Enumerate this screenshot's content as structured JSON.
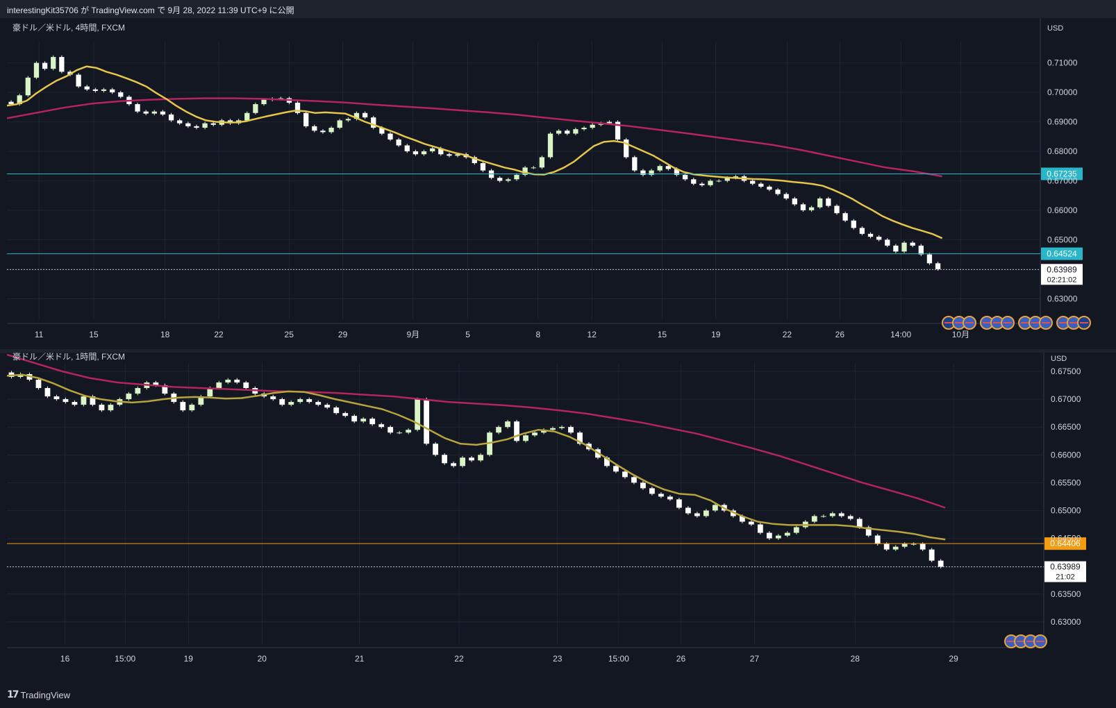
{
  "header": {
    "text": "interestingKit35706 が TradingView.com で 9月 28, 2022 11:39 UTC+9 に公開"
  },
  "footer": {
    "brand": "TradingView"
  },
  "colors": {
    "bg": "#131722",
    "grid": "#2a2e39",
    "up": "#d9f5c8",
    "down": "#ffffff",
    "ema_short": "#e5c54a",
    "ema_short_2": "#b8a43c",
    "ema_long": "#b5245e",
    "hline": "#29b6c8",
    "hline_orange": "#f39c12"
  },
  "chart_data": [
    {
      "type": "candlestick",
      "title": "豪ドル／米ドル, 4時間, FXCM",
      "currency": "USD",
      "ylim": [
        0.623,
        0.7125
      ],
      "yticks": [
        {
          "v": 0.71,
          "label": "0.71000"
        },
        {
          "v": 0.7,
          "label": "0.70000"
        },
        {
          "v": 0.69,
          "label": "0.69000"
        },
        {
          "v": 0.68,
          "label": "0.68000"
        },
        {
          "v": 0.67,
          "label": "0.67000"
        },
        {
          "v": 0.66,
          "label": "0.66000"
        },
        {
          "v": 0.65,
          "label": "0.65000"
        },
        {
          "v": 0.63,
          "label": "0.63000"
        }
      ],
      "xlim": [
        0,
        100
      ],
      "xticks": [
        {
          "x": 3.1,
          "label": "11"
        },
        {
          "x": 8.4,
          "label": "15"
        },
        {
          "x": 15.3,
          "label": "18"
        },
        {
          "x": 20.5,
          "label": "22"
        },
        {
          "x": 27.3,
          "label": "25"
        },
        {
          "x": 32.5,
          "label": "29"
        },
        {
          "x": 39.3,
          "label": "9月"
        },
        {
          "x": 44.6,
          "label": "5"
        },
        {
          "x": 51.4,
          "label": "8"
        },
        {
          "x": 56.6,
          "label": "12"
        },
        {
          "x": 63.4,
          "label": "15"
        },
        {
          "x": 68.6,
          "label": "19"
        },
        {
          "x": 75.5,
          "label": "22"
        },
        {
          "x": 80.6,
          "label": "26"
        },
        {
          "x": 86.5,
          "label": "14:00"
        },
        {
          "x": 92.3,
          "label": "10月"
        }
      ],
      "close": [
        0.696,
        0.699,
        0.705,
        0.71,
        0.708,
        0.712,
        0.707,
        0.706,
        0.702,
        0.701,
        0.7005,
        0.701,
        0.7,
        0.6985,
        0.696,
        0.6935,
        0.6928,
        0.6935,
        0.6925,
        0.6905,
        0.6895,
        0.6885,
        0.688,
        0.6895,
        0.689,
        0.6905,
        0.6895,
        0.6905,
        0.693,
        0.696,
        0.6975,
        0.6978,
        0.698,
        0.6965,
        0.693,
        0.6885,
        0.687,
        0.6865,
        0.688,
        0.6905,
        0.691,
        0.693,
        0.6915,
        0.688,
        0.686,
        0.684,
        0.682,
        0.68,
        0.679,
        0.68,
        0.681,
        0.679,
        0.6785,
        0.679,
        0.678,
        0.676,
        0.6735,
        0.671,
        0.67,
        0.6705,
        0.672,
        0.6745,
        0.6745,
        0.678,
        0.686,
        0.687,
        0.686,
        0.6875,
        0.688,
        0.689,
        0.6895,
        0.69,
        0.684,
        0.678,
        0.6735,
        0.672,
        0.6735,
        0.675,
        0.674,
        0.672,
        0.6705,
        0.669,
        0.6685,
        0.67,
        0.67,
        0.671,
        0.6715,
        0.67,
        0.669,
        0.668,
        0.667,
        0.6655,
        0.664,
        0.662,
        0.66,
        0.661,
        0.664,
        0.6615,
        0.659,
        0.6565,
        0.654,
        0.652,
        0.651,
        0.65,
        0.648,
        0.646,
        0.649,
        0.648,
        0.645,
        0.642,
        0.64
      ],
      "ema_short": [
        0.6955,
        0.696,
        0.6972,
        0.6998,
        0.702,
        0.704,
        0.7055,
        0.7075,
        0.7088,
        0.7083,
        0.707,
        0.706,
        0.7048,
        0.7035,
        0.702,
        0.6998,
        0.6978,
        0.6955,
        0.6935,
        0.6918,
        0.6905,
        0.69,
        0.6898,
        0.6898,
        0.6902,
        0.691,
        0.6918,
        0.6925,
        0.6932,
        0.6938,
        0.6936,
        0.693,
        0.6932,
        0.693,
        0.6928,
        0.6915,
        0.69,
        0.6888,
        0.6876,
        0.6864,
        0.685,
        0.6838,
        0.6825,
        0.6815,
        0.6805,
        0.6795,
        0.6788,
        0.6775,
        0.6765,
        0.6755,
        0.6745,
        0.6738,
        0.6728,
        0.6722,
        0.6721,
        0.673,
        0.6745,
        0.6765,
        0.6792,
        0.6818,
        0.6832,
        0.6835,
        0.683,
        0.6815,
        0.68,
        0.6785,
        0.6765,
        0.6745,
        0.673,
        0.6722,
        0.6718,
        0.6715,
        0.6712,
        0.671,
        0.6708,
        0.6706,
        0.6705,
        0.6703,
        0.67,
        0.6696,
        0.6693,
        0.6689,
        0.6683,
        0.667,
        0.6655,
        0.6638,
        0.6618,
        0.66,
        0.658,
        0.6565,
        0.6552,
        0.654,
        0.653,
        0.652,
        0.6505
      ],
      "ema_long": [
        0.6912,
        0.693,
        0.6948,
        0.6962,
        0.697,
        0.6975,
        0.6978,
        0.698,
        0.698,
        0.6978,
        0.6974,
        0.697,
        0.6965,
        0.6958,
        0.6952,
        0.6946,
        0.6939,
        0.6932,
        0.6924,
        0.6914,
        0.6904,
        0.6895,
        0.6885,
        0.6873,
        0.6861,
        0.6848,
        0.6835,
        0.6822,
        0.6805,
        0.6785,
        0.6765,
        0.6745,
        0.6732,
        0.6715
      ],
      "hlines": [
        {
          "v": 0.67235,
          "label": "0.67235"
        },
        {
          "v": 0.64524,
          "label": "0.64524"
        }
      ],
      "last": {
        "v": 0.63989,
        "label": "0.63989",
        "timer": "02:21:02"
      },
      "events": [
        "AUD",
        "USD",
        "USD",
        "USD",
        "USD",
        "USD",
        "USD",
        "USD",
        "USD",
        "USD",
        "USD",
        "AUD"
      ]
    },
    {
      "type": "candlestick",
      "title": "豪ドル／米ドル, 1時間, FXCM",
      "currency": "USD",
      "ylim": [
        0.626,
        0.674
      ],
      "yticks": [
        {
          "v": 0.675,
          "label": "0.67500"
        },
        {
          "v": 0.67,
          "label": "0.67000"
        },
        {
          "v": 0.665,
          "label": "0.66500"
        },
        {
          "v": 0.66,
          "label": "0.66000"
        },
        {
          "v": 0.655,
          "label": "0.65500"
        },
        {
          "v": 0.65,
          "label": "0.65000"
        },
        {
          "v": 0.645,
          "label": "0.64500"
        },
        {
          "v": 0.635,
          "label": "0.63500"
        },
        {
          "v": 0.63,
          "label": "0.63000"
        }
      ],
      "xlim": [
        0,
        100
      ],
      "xticks": [
        {
          "x": 5.6,
          "label": "16"
        },
        {
          "x": 11.4,
          "label": "15:00"
        },
        {
          "x": 17.5,
          "label": "19"
        },
        {
          "x": 24.6,
          "label": "20"
        },
        {
          "x": 34.0,
          "label": "21"
        },
        {
          "x": 43.6,
          "label": "22"
        },
        {
          "x": 53.1,
          "label": "23"
        },
        {
          "x": 59.0,
          "label": "15:00"
        },
        {
          "x": 65.0,
          "label": "26"
        },
        {
          "x": 72.1,
          "label": "27"
        },
        {
          "x": 81.8,
          "label": "28"
        },
        {
          "x": 91.3,
          "label": "29"
        }
      ],
      "close": [
        0.674,
        0.6745,
        0.6735,
        0.672,
        0.6705,
        0.67,
        0.6695,
        0.669,
        0.6705,
        0.669,
        0.668,
        0.669,
        0.67,
        0.671,
        0.672,
        0.673,
        0.6725,
        0.671,
        0.6695,
        0.668,
        0.669,
        0.6705,
        0.672,
        0.673,
        0.6735,
        0.673,
        0.672,
        0.671,
        0.6705,
        0.67,
        0.669,
        0.6695,
        0.67,
        0.6695,
        0.669,
        0.6685,
        0.6675,
        0.667,
        0.666,
        0.6665,
        0.6655,
        0.665,
        0.664,
        0.664,
        0.6645,
        0.67,
        0.662,
        0.66,
        0.6585,
        0.658,
        0.6595,
        0.659,
        0.66,
        0.664,
        0.665,
        0.666,
        0.6625,
        0.6635,
        0.664,
        0.6645,
        0.6648,
        0.665,
        0.664,
        0.662,
        0.661,
        0.6595,
        0.658,
        0.657,
        0.656,
        0.655,
        0.654,
        0.653,
        0.6525,
        0.652,
        0.6505,
        0.6495,
        0.649,
        0.65,
        0.651,
        0.65,
        0.649,
        0.648,
        0.6475,
        0.646,
        0.645,
        0.6455,
        0.646,
        0.647,
        0.648,
        0.649,
        0.649,
        0.6495,
        0.649,
        0.6485,
        0.647,
        0.6455,
        0.644,
        0.643,
        0.6435,
        0.644,
        0.644,
        0.643,
        0.641,
        0.6399
      ],
      "ema_short": [
        0.6742,
        0.6744,
        0.6738,
        0.6728,
        0.6716,
        0.6706,
        0.67,
        0.6696,
        0.6694,
        0.6696,
        0.67,
        0.6703,
        0.6704,
        0.6703,
        0.6701,
        0.6702,
        0.6706,
        0.6711,
        0.6714,
        0.6713,
        0.6707,
        0.67,
        0.6694,
        0.6688,
        0.6682,
        0.6672,
        0.666,
        0.6645,
        0.663,
        0.662,
        0.6618,
        0.6622,
        0.6628,
        0.6638,
        0.6645,
        0.6642,
        0.6632,
        0.6618,
        0.66,
        0.6582,
        0.6565,
        0.655,
        0.6538,
        0.653,
        0.6528,
        0.6518,
        0.6502,
        0.649,
        0.648,
        0.6476,
        0.6474,
        0.6474,
        0.6474,
        0.6474,
        0.6472,
        0.6468,
        0.6465,
        0.6462,
        0.6458,
        0.6452,
        0.6448
      ],
      "ema_long": [
        0.678,
        0.6765,
        0.675,
        0.6738,
        0.673,
        0.6726,
        0.6722,
        0.672,
        0.6718,
        0.6716,
        0.6714,
        0.6713,
        0.6711,
        0.6708,
        0.6705,
        0.67,
        0.6695,
        0.6692,
        0.6689,
        0.6685,
        0.668,
        0.6674,
        0.6666,
        0.6658,
        0.6648,
        0.6638,
        0.6625,
        0.6612,
        0.6598,
        0.6582,
        0.6566,
        0.655,
        0.6536,
        0.6522,
        0.6505
      ],
      "hlines": [
        {
          "v": 0.64406,
          "label": "0.64406"
        }
      ],
      "last": {
        "v": 0.63989,
        "label": "0.63989",
        "timer": "21:02"
      },
      "events": [
        "USD",
        "USD",
        "USD",
        "USD"
      ]
    }
  ]
}
